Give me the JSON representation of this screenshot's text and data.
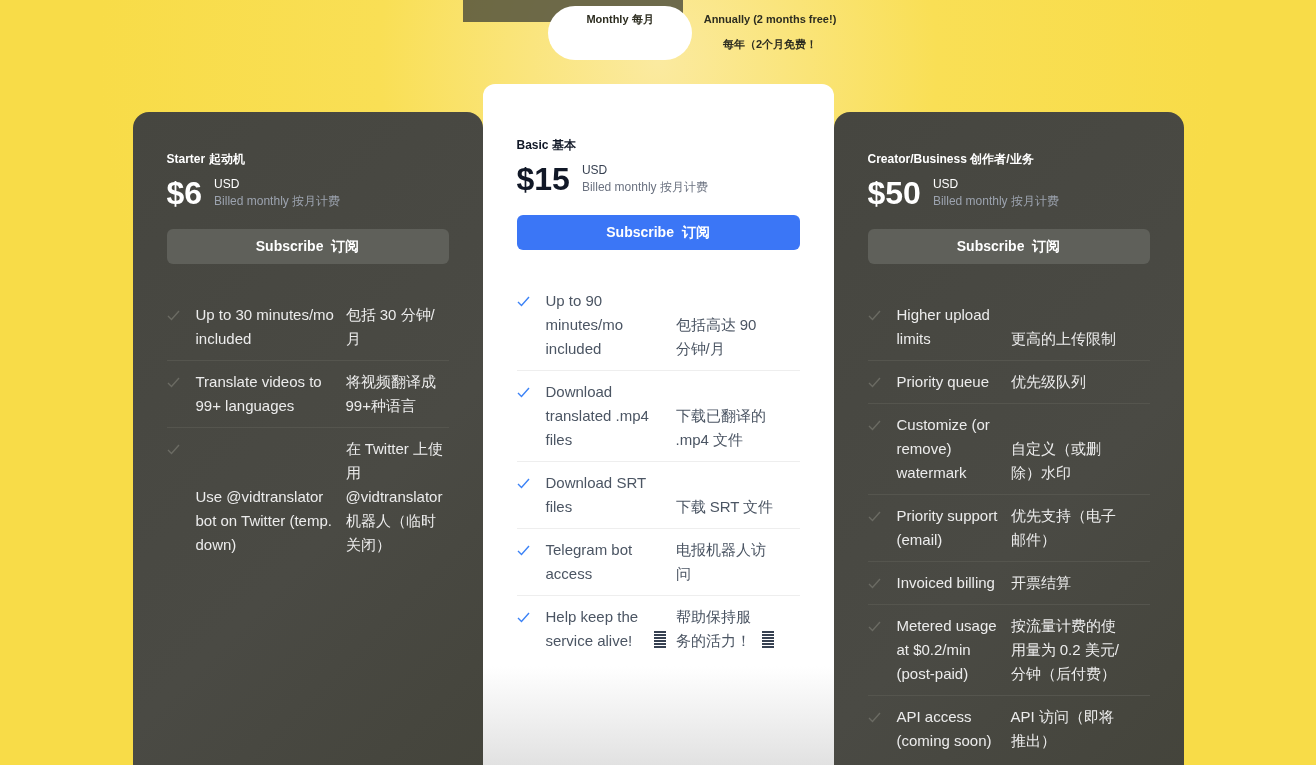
{
  "billing_toggle": [
    {
      "label": "Monthly 每月",
      "selected": true
    },
    {
      "label": "Annually (2 months free!)",
      "sublabel": "每年（2个月免费！",
      "selected": false
    }
  ],
  "plans": [
    {
      "name": "Starter 起动机",
      "price": "$6",
      "currency": "USD",
      "billing": "Billed monthly 按月计费",
      "button": "Subscribe  订阅",
      "featured": false,
      "features": [
        {
          "kind": "text",
          "en": "Up to 30 minutes/mo included",
          "zh": "包括 30 分钟/月"
        },
        {
          "kind": "text",
          "en": "Translate videos to 99+ languages",
          "zh": "将视频翻译成99+种语言"
        },
        {
          "kind": "text",
          "en": "Use @vidtranslator bot on Twitter (temp. down)",
          "zh": "在 Twitter 上使用 @vidtranslator 机器人（临时关闭）"
        }
      ]
    },
    {
      "name": "Basic 基本",
      "price": "$15",
      "currency": "USD",
      "billing": "Billed monthly 按月计费",
      "button": "Subscribe  订阅",
      "featured": true,
      "features": [
        {
          "kind": "text",
          "en": "Up to 90 minutes/mo included",
          "zh": "包括高达 90 分钟/月"
        },
        {
          "kind": "text",
          "en": "Download translated .mp4 files",
          "zh": "下载已翻译的 .mp4 文件"
        },
        {
          "kind": "text",
          "en": "Download SRT files",
          "zh": "下载 SRT 文件"
        },
        {
          "kind": "text",
          "en": "Telegram bot access",
          "zh": "电报机器人访问"
        },
        {
          "kind": "with-icon",
          "en": "Help keep the service alive!",
          "zh": "帮助保持服务的活力！"
        }
      ]
    },
    {
      "name": "Creator/Business 创作者/业务",
      "price": "$50",
      "currency": "USD",
      "billing": "Billed monthly 按月计费",
      "button": "Subscribe  订阅",
      "featured": false,
      "features": [
        {
          "kind": "text",
          "en": "Higher upload limits",
          "zh": "更高的上传限制"
        },
        {
          "kind": "text",
          "en": "Priority queue",
          "zh": "优先级队列"
        },
        {
          "kind": "text",
          "en": "Customize (or remove) watermark",
          "zh": "自定义（或删除）水印"
        },
        {
          "kind": "text",
          "en": "Priority support (email)",
          "zh": "优先支持（电子邮件）"
        },
        {
          "kind": "text",
          "en": "Invoiced billing",
          "zh": "开票结算"
        },
        {
          "kind": "text",
          "en": "Metered usage at $0.2/min (post-paid)",
          "zh": "按流量计费的使用量为 0.2 美元/分钟（后付费）"
        },
        {
          "kind": "text",
          "en": "API access (coming soon)",
          "zh": "API 访问（即将推出）"
        }
      ]
    }
  ]
}
